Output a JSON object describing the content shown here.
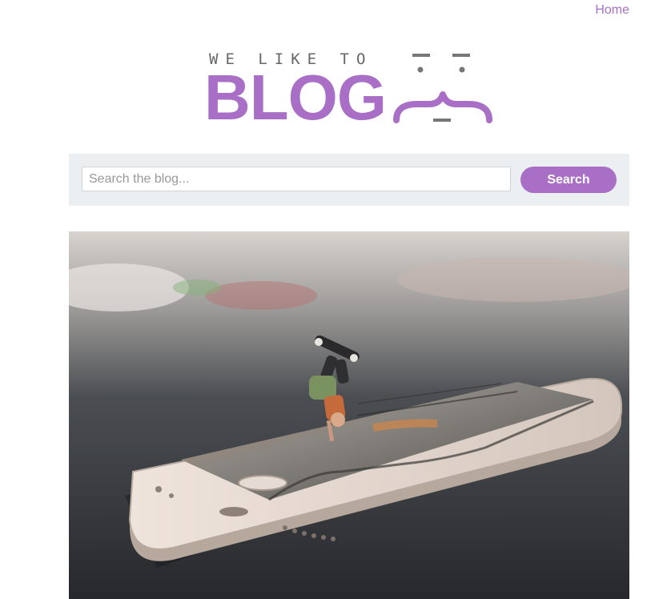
{
  "nav": {
    "home_label": "Home"
  },
  "logo": {
    "tagline": "WE LIKE TO",
    "word": "BLOG"
  },
  "search": {
    "placeholder": "Search the blog...",
    "value": "",
    "button_label": "Search"
  },
  "hero_image": {
    "alt": "Skateboarder doing a handstand trick emerging from a smartphone screen"
  },
  "colors": {
    "accent": "#a96ec6",
    "search_bar_bg": "#ebeff1"
  }
}
